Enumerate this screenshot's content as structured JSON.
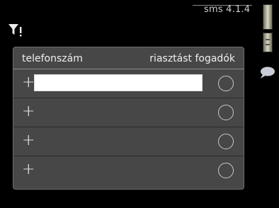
{
  "header": {
    "menu_code": "sms 4.1.4",
    "icon": "filter-icon"
  },
  "table": {
    "columns": {
      "phone_number": "telefonszám",
      "receives_alarm": "riasztást fogadók"
    },
    "rows": [
      {
        "add_label": "+",
        "phone_value": "",
        "receives_alarm": false
      },
      {
        "add_label": "+",
        "receives_alarm": false
      },
      {
        "add_label": "+",
        "receives_alarm": false
      },
      {
        "add_label": "+",
        "receives_alarm": false
      }
    ]
  },
  "sidebar": {
    "scroll_icon": "scrollbar",
    "help_icon": "help-bubble-icon"
  },
  "colors": {
    "background": "#000000",
    "panel": "#474747",
    "text": "#efefef"
  }
}
